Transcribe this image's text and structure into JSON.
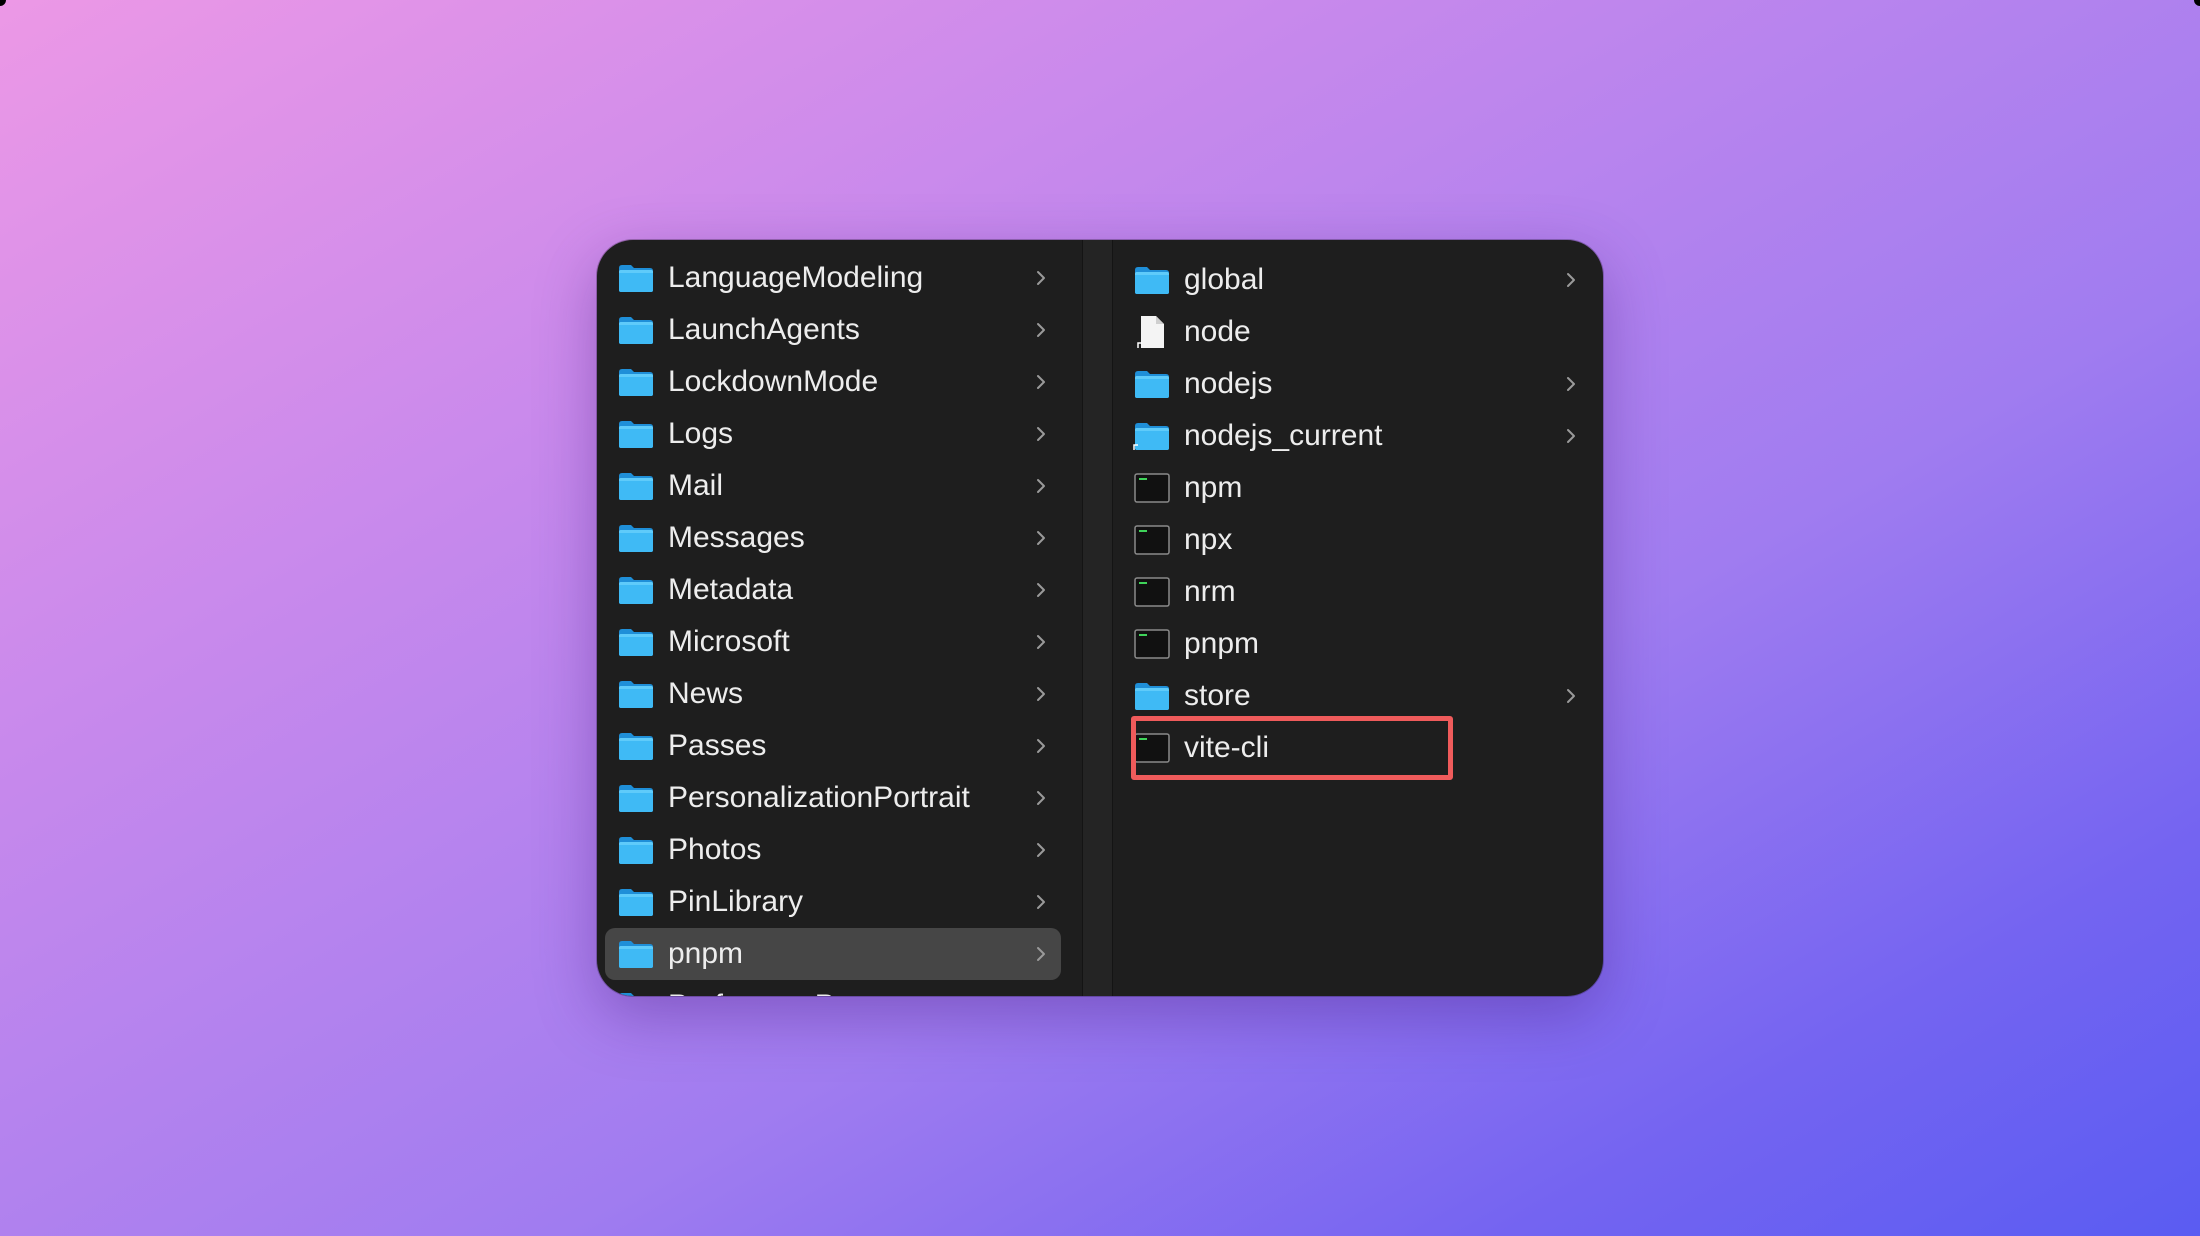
{
  "finder": {
    "parent_column": {
      "items": [
        {
          "label": "LanguageModeling",
          "icon": "folder-icon",
          "has_children": true
        },
        {
          "label": "LaunchAgents",
          "icon": "folder-icon",
          "has_children": true
        },
        {
          "label": "LockdownMode",
          "icon": "folder-icon",
          "has_children": true
        },
        {
          "label": "Logs",
          "icon": "folder-icon",
          "has_children": true
        },
        {
          "label": "Mail",
          "icon": "folder-icon",
          "has_children": true
        },
        {
          "label": "Messages",
          "icon": "folder-icon",
          "has_children": true
        },
        {
          "label": "Metadata",
          "icon": "folder-icon",
          "has_children": true
        },
        {
          "label": "Microsoft",
          "icon": "folder-icon",
          "has_children": true
        },
        {
          "label": "News",
          "icon": "folder-icon",
          "has_children": true
        },
        {
          "label": "Passes",
          "icon": "folder-icon",
          "has_children": true
        },
        {
          "label": "PersonalizationPortrait",
          "icon": "folder-icon",
          "has_children": true
        },
        {
          "label": "Photos",
          "icon": "folder-icon",
          "has_children": true
        },
        {
          "label": "PinLibrary",
          "icon": "folder-icon",
          "has_children": true
        },
        {
          "label": "pnpm",
          "icon": "folder-icon",
          "has_children": true,
          "selected": true
        },
        {
          "label": "PreferencePanes",
          "icon": "folder-icon",
          "has_children": true
        }
      ]
    },
    "child_column": {
      "items": [
        {
          "label": "global",
          "icon": "folder-icon",
          "has_children": true
        },
        {
          "label": "node",
          "icon": "alias-document-icon",
          "has_children": false
        },
        {
          "label": "nodejs",
          "icon": "folder-icon",
          "has_children": true
        },
        {
          "label": "nodejs_current",
          "icon": "alias-folder-icon",
          "has_children": true
        },
        {
          "label": "npm",
          "icon": "terminal-executable-icon",
          "has_children": false
        },
        {
          "label": "npx",
          "icon": "terminal-executable-icon",
          "has_children": false
        },
        {
          "label": "nrm",
          "icon": "terminal-executable-icon",
          "has_children": false
        },
        {
          "label": "pnpm",
          "icon": "terminal-executable-icon",
          "has_children": false
        },
        {
          "label": "store",
          "icon": "folder-icon",
          "has_children": true
        },
        {
          "label": "vite-cli",
          "icon": "terminal-executable-icon",
          "has_children": false,
          "highlighted": true
        }
      ]
    }
  },
  "colors": {
    "window_bg": "#1e1e1e",
    "selected_row": "#464646",
    "folder_blue": "#39b6f4",
    "highlight_red": "#ef5b5b",
    "text": "#ededed"
  }
}
